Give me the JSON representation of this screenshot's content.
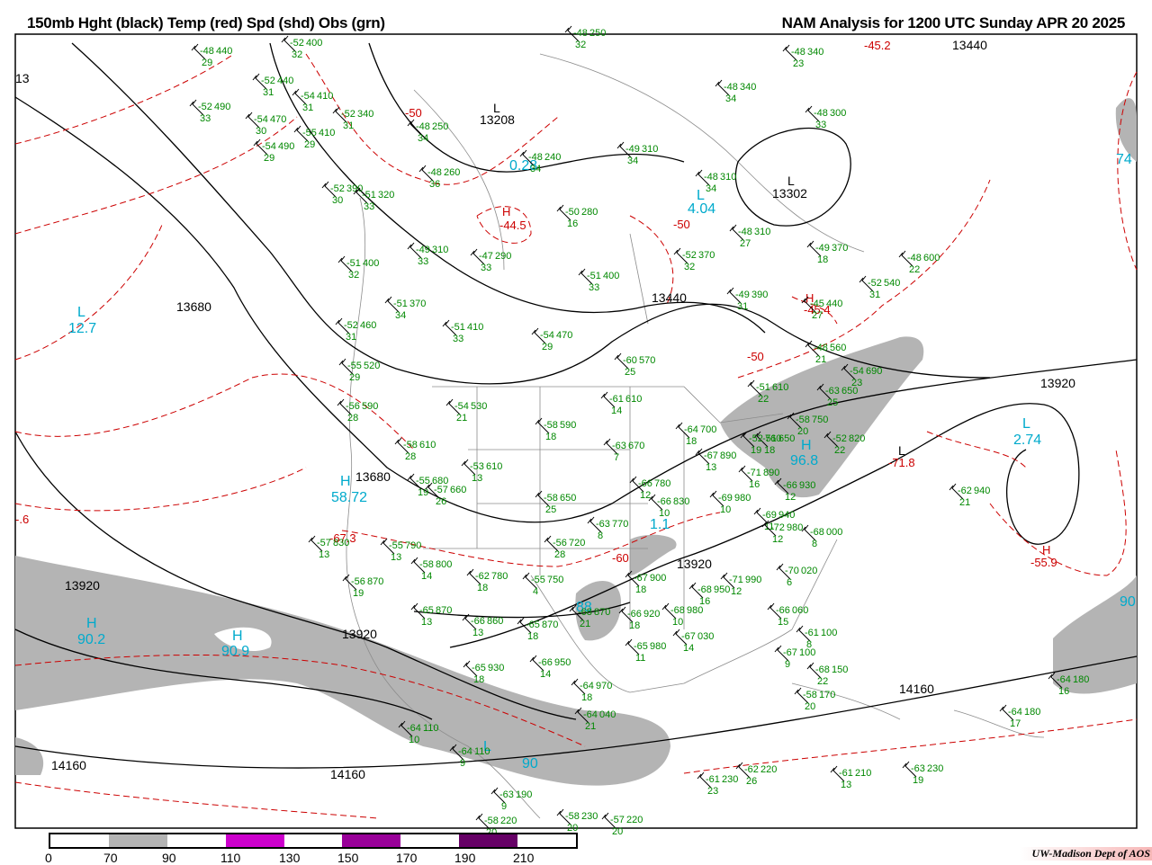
{
  "header": {
    "left_title": "150mb Hght (black) Temp (red) Spd (shd) Obs (grn)",
    "right_title": "NAM Analysis for 1200 UTC Sunday  APR 20 2025"
  },
  "colors": {
    "shade_70_90": "#b4b4b4",
    "shade_110_130": "#cc00cc",
    "shade_150_170": "#990099",
    "shade_190_210": "#660066",
    "height": "#000000",
    "temp": "#cc0000",
    "obs": "#008800",
    "speed_label": "#00aacc"
  },
  "legend": {
    "ticks": [
      "0",
      "70",
      "90",
      "110",
      "130",
      "150",
      "170",
      "190",
      "210"
    ]
  },
  "credit": "UW-Madison  Dept of AOS",
  "height_labels": [
    "13680",
    "13680",
    "13920",
    "13920",
    "13920",
    "13920",
    "13440",
    "13440",
    "13208",
    "13302",
    "14160",
    "14160",
    "14160",
    "13"
  ],
  "temp_labels": [
    "-45.2",
    "-50",
    "-44.5",
    "-50",
    "-45.4",
    "-50",
    "-71.8",
    "-55.9",
    "-67.3",
    "-60",
    "-.6"
  ],
  "speed_labels": [
    "0.28",
    "4.04",
    "12.7",
    "58.72",
    "90.2",
    "90.9",
    "96.8",
    "2.74",
    "74",
    "90",
    "1.1",
    "90",
    "88"
  ],
  "hl_labels": {
    "L": "L",
    "H": "H"
  },
  "stations": [
    [
      "-48",
      "440",
      "29"
    ],
    [
      "-52",
      "400",
      "32"
    ],
    [
      "-52",
      "440",
      "31"
    ],
    [
      "-54",
      "410",
      "31"
    ],
    [
      "-52",
      "490",
      "33"
    ],
    [
      "-54",
      "470",
      "30"
    ],
    [
      "-55",
      "410",
      "29"
    ],
    [
      "-54",
      "490",
      "29"
    ],
    [
      "-52",
      "340",
      "31"
    ],
    [
      "-48",
      "250",
      "34"
    ],
    [
      "-48",
      "240",
      "34"
    ],
    [
      "-48",
      "260",
      "36"
    ],
    [
      "-52",
      "390",
      "30"
    ],
    [
      "-51",
      "320",
      "33"
    ],
    [
      "-49",
      "310",
      "33"
    ],
    [
      "-47",
      "290",
      "33"
    ],
    [
      "-50",
      "280",
      "16"
    ],
    [
      "-48",
      "340",
      "23"
    ],
    [
      "-48",
      "340",
      "34"
    ],
    [
      "-49",
      "310",
      "34"
    ],
    [
      "-48",
      "300",
      "33"
    ],
    [
      "-48",
      "310",
      "34"
    ],
    [
      "-48",
      "310",
      "27"
    ],
    [
      "-52",
      "370",
      "32"
    ],
    [
      "-49",
      "370",
      "18"
    ],
    [
      "-51",
      "400",
      "32"
    ],
    [
      "-51",
      "400",
      "33"
    ],
    [
      "-51",
      "370",
      "34"
    ],
    [
      "-51",
      "410",
      "33"
    ],
    [
      "-52",
      "460",
      "31"
    ],
    [
      "-54",
      "470",
      "29"
    ],
    [
      "-49",
      "390",
      "31"
    ],
    [
      "-45",
      "440",
      "27"
    ],
    [
      "-52",
      "540",
      "31"
    ],
    [
      "-48",
      "600",
      "22"
    ],
    [
      "-55",
      "520",
      "29"
    ],
    [
      "-56",
      "590",
      "28"
    ],
    [
      "-54",
      "530",
      "21"
    ],
    [
      "-58",
      "590",
      "18"
    ],
    [
      "-60",
      "570",
      "25"
    ],
    [
      "-61",
      "610",
      "14"
    ],
    [
      "-48",
      "560",
      "21"
    ],
    [
      "-54",
      "690",
      "23"
    ],
    [
      "-63",
      "650",
      "25"
    ],
    [
      "-58",
      "610",
      "28"
    ],
    [
      "-55",
      "680",
      "19"
    ],
    [
      "-57",
      "660",
      "26"
    ],
    [
      "-53",
      "610",
      "13"
    ],
    [
      "-63",
      "670",
      "7"
    ],
    [
      "-64",
      "700",
      "18"
    ],
    [
      "-51",
      "610",
      "22"
    ],
    [
      "-51",
      "650",
      "18"
    ],
    [
      "-58",
      "750",
      "20"
    ],
    [
      "-52",
      "760",
      "19"
    ],
    [
      "-52",
      "820",
      "22"
    ],
    [
      "-67",
      "890",
      "13"
    ],
    [
      "-71",
      "890",
      "16"
    ],
    [
      "-66",
      "930",
      "12"
    ],
    [
      "-66",
      "780",
      "12"
    ],
    [
      "-66",
      "830",
      "10"
    ],
    [
      "-69",
      "980",
      "10"
    ],
    [
      "-58",
      "650",
      "25"
    ],
    [
      "-56",
      "720",
      "28"
    ],
    [
      "-63",
      "770",
      "8"
    ],
    [
      "-55",
      "790",
      "13"
    ],
    [
      "-57",
      "830",
      "13"
    ],
    [
      "-56",
      "870",
      "19"
    ],
    [
      "-58",
      "800",
      "14"
    ],
    [
      "-62",
      "780",
      "18"
    ],
    [
      "-55",
      "750",
      "4"
    ],
    [
      "-67",
      "900",
      "18"
    ],
    [
      "-68",
      "950",
      "16"
    ],
    [
      "-71",
      "990",
      "12"
    ],
    [
      "-68",
      "980",
      "10"
    ],
    [
      "-69",
      "940",
      "11"
    ],
    [
      "-72",
      "980",
      "12"
    ],
    [
      "-68",
      "000",
      "8"
    ],
    [
      "-70",
      "020",
      "6"
    ],
    [
      "-65",
      "870",
      "13"
    ],
    [
      "-66",
      "860",
      "13"
    ],
    [
      "-65",
      "870",
      "18"
    ],
    [
      "-68",
      "870",
      "21"
    ],
    [
      "-66",
      "920",
      "18"
    ],
    [
      "-65",
      "980",
      "11"
    ],
    [
      "-67",
      "030",
      "14"
    ],
    [
      "-66",
      "060",
      "15"
    ],
    [
      "-61",
      "100",
      "8"
    ],
    [
      "-67",
      "100",
      "9"
    ],
    [
      "-68",
      "150",
      "22"
    ],
    [
      "-58",
      "170",
      "20"
    ],
    [
      "-65",
      "930",
      "18"
    ],
    [
      "-66",
      "950",
      "14"
    ],
    [
      "-64",
      "970",
      "18"
    ],
    [
      "-64",
      "040",
      "21"
    ],
    [
      "-64",
      "180",
      "16"
    ],
    [
      "-64",
      "180",
      "17"
    ],
    [
      "-62",
      "940",
      "21"
    ],
    [
      "-64",
      "110",
      "10"
    ],
    [
      "-64",
      "110",
      "9"
    ],
    [
      "-63",
      "190",
      "9"
    ],
    [
      "-58",
      "220",
      "20"
    ],
    [
      "-58",
      "230",
      "20"
    ],
    [
      "-57",
      "220",
      "20"
    ],
    [
      "-61",
      "230",
      "23"
    ],
    [
      "-62",
      "220",
      "26"
    ],
    [
      "-61",
      "210",
      "13"
    ],
    [
      "-63",
      "230",
      "19"
    ],
    [
      "-48",
      "250",
      "32"
    ]
  ]
}
